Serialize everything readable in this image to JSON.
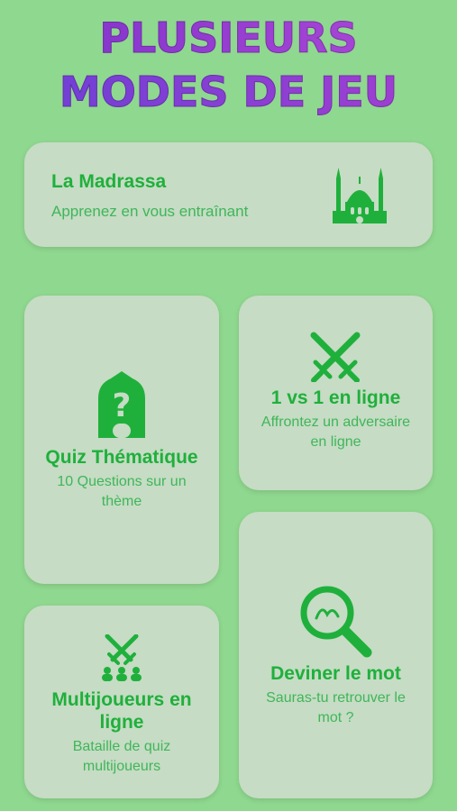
{
  "header": {
    "line1": "PLUSIEURS",
    "line2": "MODES DE JEU"
  },
  "modes": [
    {
      "title": "La Madrassa",
      "subtitle": "Apprenez en vous entraînant",
      "icon": "mosque-icon"
    },
    {
      "title": "Quiz Thématique",
      "subtitle": "10 Questions sur un thème",
      "icon": "question-dome-icon"
    },
    {
      "title": "1 vs 1 en ligne",
      "subtitle": "Affrontez un adversaire en ligne",
      "icon": "crossed-swords-icon"
    },
    {
      "title": "Deviner le mot",
      "subtitle": "Sauras-tu retrouver le mot ?",
      "icon": "magnifier-icon"
    },
    {
      "title": "Multijoueurs en ligne",
      "subtitle": "Bataille de quiz multijoueurs",
      "icon": "multiplayer-swords-icon"
    }
  ],
  "colors": {
    "background": "#8fd88f",
    "card": "#c6dcc4",
    "accent": "#1fb03c",
    "heading_start": "#7b32c9",
    "heading_end": "#b14ad8"
  }
}
